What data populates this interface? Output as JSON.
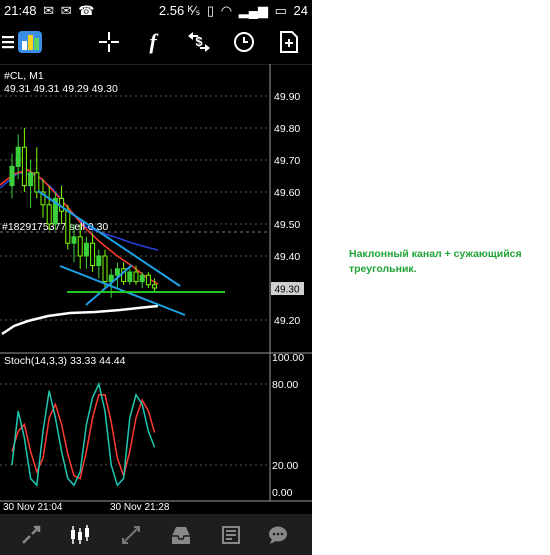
{
  "status_bar": {
    "time": "21:48",
    "left_icons": [
      "message-icon",
      "message-icon",
      "viber-icon"
    ],
    "speed": "2.56 ᴷ⁄ₛ",
    "battery": "24"
  },
  "toolbar": {
    "items": [
      "menu-icon",
      "app-logo-icon",
      "crosshair-icon",
      "function-icon",
      "trade-icon",
      "clock-icon",
      "new-chart-icon"
    ]
  },
  "chart": {
    "symbol_line": "#CL, M1",
    "ohlc_line": "49.31 49.31 49.29 49.30",
    "order_label": "#1829175377 sell 0.30",
    "current_price_tag": "49.30",
    "price_labels": [
      "49.90",
      "49.80",
      "49.70",
      "49.60",
      "49.50",
      "49.40",
      "49.20"
    ],
    "stoch_title": "Stoch(14,3,3) 33.33 44.44",
    "stoch_labels": [
      "100.00",
      "80.00",
      "20.00",
      "0.00"
    ],
    "time_labels": [
      "30 Nov 21:04",
      "30 Nov 21:28"
    ],
    "colors": {
      "bull": "#3cd13c",
      "bear": "#7cfc00",
      "ma_red": "#ff3b30",
      "ma_blue": "#2a3fd9",
      "trendline": "#1ea0e6",
      "hline": "#23c623"
    }
  },
  "chart_data": {
    "type": "candlestick",
    "price_range": [
      49.13,
      49.95
    ],
    "candles": [
      {
        "o": 49.62,
        "h": 49.72,
        "l": 49.58,
        "c": 49.68
      },
      {
        "o": 49.68,
        "h": 49.78,
        "l": 49.64,
        "c": 49.74
      },
      {
        "o": 49.74,
        "h": 49.8,
        "l": 49.6,
        "c": 49.62
      },
      {
        "o": 49.62,
        "h": 49.7,
        "l": 49.55,
        "c": 49.66
      },
      {
        "o": 49.66,
        "h": 49.74,
        "l": 49.58,
        "c": 49.6
      },
      {
        "o": 49.6,
        "h": 49.64,
        "l": 49.52,
        "c": 49.56
      },
      {
        "o": 49.56,
        "h": 49.62,
        "l": 49.48,
        "c": 49.5
      },
      {
        "o": 49.5,
        "h": 49.6,
        "l": 49.48,
        "c": 49.58
      },
      {
        "o": 49.58,
        "h": 49.62,
        "l": 49.5,
        "c": 49.54
      },
      {
        "o": 49.54,
        "h": 49.56,
        "l": 49.42,
        "c": 49.44
      },
      {
        "o": 49.44,
        "h": 49.5,
        "l": 49.38,
        "c": 49.46
      },
      {
        "o": 49.46,
        "h": 49.5,
        "l": 49.36,
        "c": 49.4
      },
      {
        "o": 49.4,
        "h": 49.46,
        "l": 49.36,
        "c": 49.44
      },
      {
        "o": 49.44,
        "h": 49.47,
        "l": 49.35,
        "c": 49.37
      },
      {
        "o": 49.37,
        "h": 49.42,
        "l": 49.33,
        "c": 49.4
      },
      {
        "o": 49.4,
        "h": 49.42,
        "l": 49.3,
        "c": 49.32
      },
      {
        "o": 49.32,
        "h": 49.36,
        "l": 49.27,
        "c": 49.34
      },
      {
        "o": 49.34,
        "h": 49.38,
        "l": 49.3,
        "c": 49.36
      },
      {
        "o": 49.36,
        "h": 49.38,
        "l": 49.31,
        "c": 49.32
      },
      {
        "o": 49.32,
        "h": 49.36,
        "l": 49.31,
        "c": 49.35
      },
      {
        "o": 49.35,
        "h": 49.37,
        "l": 49.31,
        "c": 49.32
      },
      {
        "o": 49.32,
        "h": 49.35,
        "l": 49.3,
        "c": 49.34
      },
      {
        "o": 49.34,
        "h": 49.35,
        "l": 49.3,
        "c": 49.31
      },
      {
        "o": 49.31,
        "h": 49.33,
        "l": 49.29,
        "c": 49.3
      }
    ],
    "stochastic": {
      "k": [
        20,
        60,
        40,
        10,
        5,
        45,
        75,
        55,
        30,
        10,
        5,
        15,
        50,
        70,
        80,
        60,
        20,
        5,
        10,
        55,
        72,
        65,
        45,
        33
      ],
      "d": [
        30,
        45,
        50,
        30,
        15,
        25,
        55,
        65,
        50,
        28,
        12,
        10,
        30,
        55,
        72,
        72,
        52,
        25,
        12,
        30,
        55,
        68,
        60,
        44
      ]
    }
  },
  "bottom_nav": {
    "items": [
      "quotes-icon",
      "chart-icon",
      "trade-icon",
      "history-icon",
      "news-icon",
      "messages-icon"
    ],
    "active_index": 1
  },
  "annotation": {
    "text": "Наклонный канал + сужающийся треугольник."
  }
}
